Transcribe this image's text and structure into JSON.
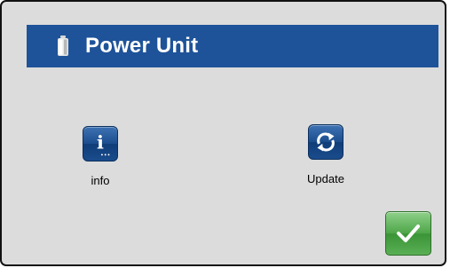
{
  "dialog": {
    "title": "Power Unit",
    "title_icon": "battery-icon",
    "title_bar_color": "#1e5399",
    "background_color": "#dcdcdc"
  },
  "apps": [
    {
      "label": "info",
      "icon": "info-icon"
    },
    {
      "label": "Update",
      "icon": "refresh-icon"
    }
  ],
  "confirm_button": {
    "icon": "checkmark-icon",
    "color": "#4ea649"
  }
}
